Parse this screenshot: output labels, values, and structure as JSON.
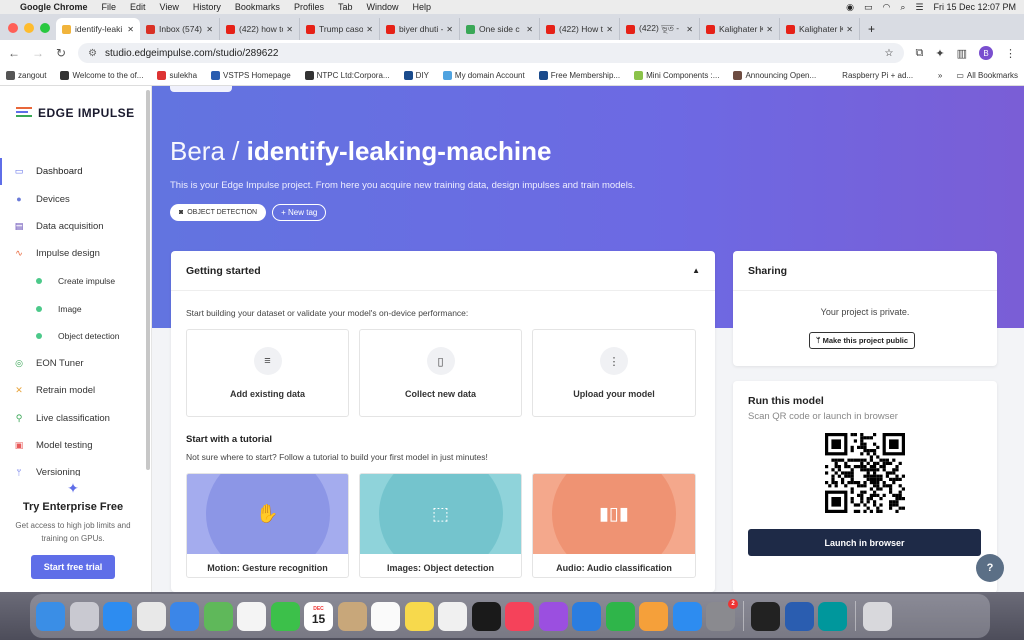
{
  "mac_menu": {
    "app": "Google Chrome",
    "items": [
      "File",
      "Edit",
      "View",
      "History",
      "Bookmarks",
      "Profiles",
      "Tab",
      "Window",
      "Help"
    ],
    "clock": "Fri 15 Dec  12:07 PM"
  },
  "tabs": [
    {
      "label": "identify-leaki",
      "color": "#f1b43c",
      "active": true
    },
    {
      "label": "Inbox (574) -",
      "color": "#d93025"
    },
    {
      "label": "(422) how to",
      "color": "#e62117"
    },
    {
      "label": "Trump caso c",
      "color": "#e62117"
    },
    {
      "label": "biyer dhuti -",
      "color": "#e62117"
    },
    {
      "label": "One side c",
      "color": "#3aa757"
    },
    {
      "label": "(422) How to",
      "color": "#e62117"
    },
    {
      "label": "(422) ভূত -",
      "color": "#e62117"
    },
    {
      "label": "Kalighater Ka",
      "color": "#e62117"
    },
    {
      "label": "Kalighater Ka",
      "color": "#e62117"
    }
  ],
  "address": {
    "url": "studio.edgeimpulse.com/studio/289622",
    "profile_initial": "B"
  },
  "bookmarks": [
    {
      "label": "zangout",
      "color": "#555"
    },
    {
      "label": "Welcome to the of...",
      "color": "#333"
    },
    {
      "label": "sulekha",
      "color": "#d33"
    },
    {
      "label": "VSTPS Homepage",
      "color": "#2a5db0"
    },
    {
      "label": "NTPC Ltd:Corpora...",
      "color": "#333"
    },
    {
      "label": "DIY",
      "color": "#1a4b8c"
    },
    {
      "label": "My domain Account",
      "color": "#4fa3e0"
    },
    {
      "label": "Free Membership...",
      "color": "#1a4b8c"
    },
    {
      "label": "Mini Components :...",
      "color": "#8bc34a"
    },
    {
      "label": "Announcing Open...",
      "color": "#6d4c41"
    },
    {
      "label": "Raspberry Pi + ad...",
      "color": "#fff"
    }
  ],
  "all_bookmarks": "All Bookmarks",
  "sidebar": {
    "logo": "EDGE IMPULSE",
    "items": [
      {
        "label": "Dashboard",
        "icon": "monitor-icon",
        "glyph": "▭",
        "color": "#5f6ee8",
        "active": true
      },
      {
        "label": "Devices",
        "icon": "device-icon",
        "glyph": "●",
        "color": "#6b7bd8"
      },
      {
        "label": "Data acquisition",
        "icon": "database-icon",
        "glyph": "▤",
        "color": "#5a3fb0"
      },
      {
        "label": "Impulse design",
        "icon": "pulse-icon",
        "glyph": "∿",
        "color": "#e8673a"
      },
      {
        "label": "Create impulse",
        "sub": true
      },
      {
        "label": "Image",
        "sub": true
      },
      {
        "label": "Object detection",
        "sub": true
      },
      {
        "label": "EON Tuner",
        "icon": "tuner-icon",
        "glyph": "◎",
        "color": "#3aa757"
      },
      {
        "label": "Retrain model",
        "icon": "retrain-icon",
        "glyph": "✕",
        "color": "#e8a33a"
      },
      {
        "label": "Live classification",
        "icon": "live-icon",
        "glyph": "⚲",
        "color": "#3aa757"
      },
      {
        "label": "Model testing",
        "icon": "clipboard-icon",
        "glyph": "▣",
        "color": "#e85a5a"
      },
      {
        "label": "Versioning",
        "icon": "branch-icon",
        "glyph": "ᛘ",
        "color": "#5f6ee8"
      }
    ],
    "enterprise": {
      "title": "Try Enterprise Free",
      "desc": "Get access to high job limits and training on GPUs.",
      "button": "Start free trial"
    }
  },
  "hero": {
    "owner": "Bera /",
    "project": "identify-leaking-machine",
    "subtitle": "This is your Edge Impulse project. From here you acquire new training data, design impulses and train models.",
    "tag": "OBJECT DETECTION",
    "new_tag": "New tag"
  },
  "getting_started": {
    "title": "Getting started",
    "intro": "Start building your dataset or validate your model's on-device performance:",
    "cards": [
      {
        "label": "Add existing data",
        "icon": "database-icon",
        "glyph": "≡"
      },
      {
        "label": "Collect new data",
        "icon": "phone-icon",
        "glyph": "▯"
      },
      {
        "label": "Upload your model",
        "icon": "network-icon",
        "glyph": "⋮"
      }
    ],
    "tutorial_title": "Start with a tutorial",
    "tutorial_desc": "Not sure where to start? Follow a tutorial to build your first model in just minutes!",
    "tutorials": [
      {
        "label": "Motion: Gesture recognition",
        "icon": "hand-icon",
        "glyph": "✋",
        "outer": "#a4acee",
        "inner": "#8c96e6"
      },
      {
        "label": "Images: Object detection",
        "icon": "image-frame-icon",
        "glyph": "⬚",
        "outer": "#8fd3da",
        "inner": "#74c4cd"
      },
      {
        "label": "Audio: Audio classification",
        "icon": "waveform-icon",
        "glyph": "▮▯▮",
        "outer": "#f4a88c",
        "inner": "#ef9373"
      }
    ]
  },
  "sharing": {
    "title": "Sharing",
    "text": "Your project is private.",
    "button": "Make this project public"
  },
  "run_model": {
    "title": "Run this model",
    "subtitle": "Scan QR code or launch in browser",
    "button": "Launch in browser"
  },
  "help_label": "?",
  "dock": [
    {
      "name": "finder",
      "color": "#3a8ee6"
    },
    {
      "name": "launchpad",
      "color": "#c9c9d1"
    },
    {
      "name": "safari",
      "color": "#2d8cf0"
    },
    {
      "name": "chrome",
      "color": "#e8e8e8"
    },
    {
      "name": "mail",
      "color": "#3b86e8"
    },
    {
      "name": "maps",
      "color": "#5fb85a"
    },
    {
      "name": "photos",
      "color": "#f4f4f4"
    },
    {
      "name": "facetime",
      "color": "#3cc04a"
    },
    {
      "name": "calendar",
      "color": "#ffffff"
    },
    {
      "name": "contacts",
      "color": "#c8a77a"
    },
    {
      "name": "reminders",
      "color": "#fafafa"
    },
    {
      "name": "notes",
      "color": "#f7d94c"
    },
    {
      "name": "freeform",
      "color": "#f0f0f0"
    },
    {
      "name": "apple-tv",
      "color": "#1a1a1a"
    },
    {
      "name": "music",
      "color": "#f5425a"
    },
    {
      "name": "podcasts",
      "color": "#9b4fe0"
    },
    {
      "name": "keynote",
      "color": "#2a7de0"
    },
    {
      "name": "numbers",
      "color": "#2fb54a"
    },
    {
      "name": "pages",
      "color": "#f5a03a"
    },
    {
      "name": "app-store",
      "color": "#2d8cf0"
    },
    {
      "name": "system-settings",
      "color": "#8a8a8f"
    },
    {
      "name": "terminal",
      "color": "#222"
    },
    {
      "name": "vpn",
      "color": "#2a5db0"
    },
    {
      "name": "arduino",
      "color": "#00979c"
    },
    {
      "name": "trash",
      "color": "#d8d8dc"
    }
  ],
  "calendar_day": "15",
  "calendar_month": "DEC",
  "settings_badge": "2"
}
